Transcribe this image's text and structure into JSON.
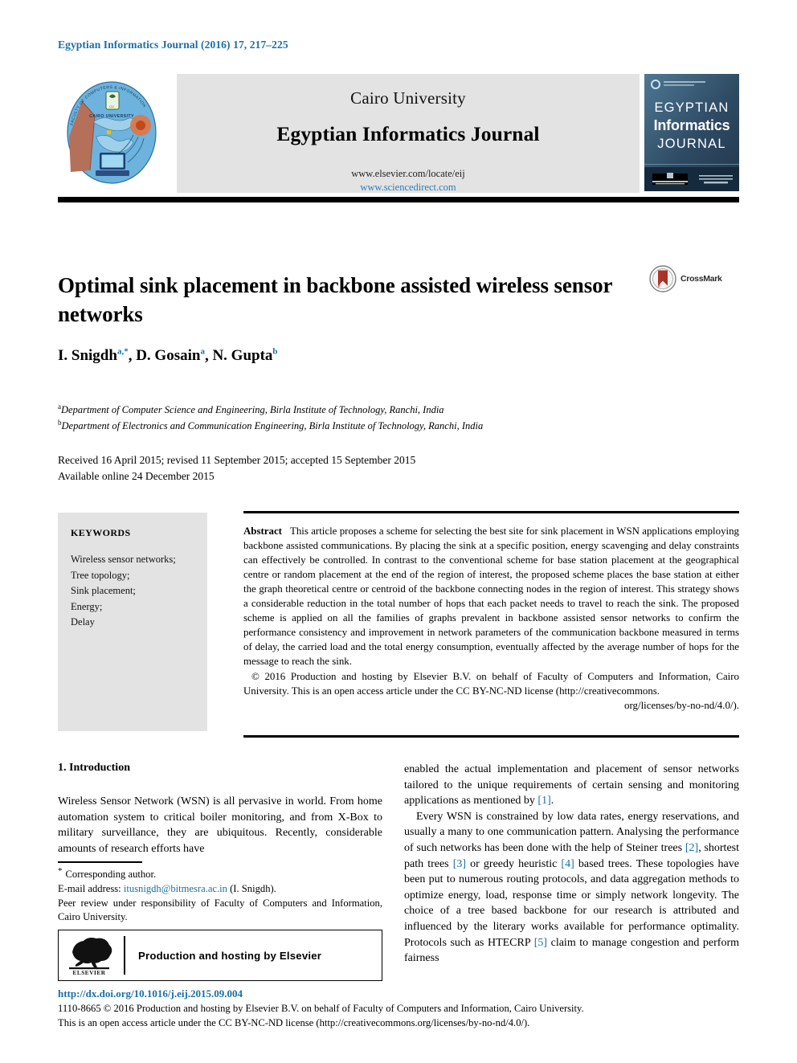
{
  "running_head": "Egyptian Informatics Journal (2016) 17, 217–225",
  "header": {
    "seal_alt": "cairo-university-faculty-of-computers-and-information-seal",
    "university": "Cairo University",
    "journal_name": "Egyptian Informatics Journal",
    "url_elsevier": "www.elsevier.com/locate/eij",
    "url_sciencedirect": "www.sciencedirect.com",
    "cover": {
      "line1": "EGYPTIAN",
      "line2": "Informatics",
      "line3": "JOURNAL"
    }
  },
  "article": {
    "title": "Optimal sink placement in backbone assisted wireless sensor networks",
    "crossmark_label": "CrossMark",
    "authors": [
      {
        "name": "I. Snigdh",
        "sup": "a,*"
      },
      {
        "name": "D. Gosain",
        "sup": "a"
      },
      {
        "name": "N. Gupta",
        "sup": "b"
      }
    ],
    "affiliations": [
      {
        "sup": "a",
        "text": "Department of Computer Science and Engineering, Birla Institute of Technology, Ranchi, India"
      },
      {
        "sup": "b",
        "text": "Department of Electronics and Communication Engineering, Birla Institute of Technology, Ranchi, India"
      }
    ],
    "dates_line1": "Received 16 April 2015; revised 11 September 2015; accepted 15 September 2015",
    "dates_line2": "Available online 24 December 2015"
  },
  "keywords": {
    "heading": "KEYWORDS",
    "items": [
      "Wireless sensor networks;",
      "Tree topology;",
      "Sink placement;",
      "Energy;",
      "Delay"
    ]
  },
  "abstract": {
    "label": "Abstract",
    "text": "This article proposes a scheme for selecting the best site for sink placement in WSN applications employing backbone assisted communications. By placing the sink at a specific position, energy scavenging and delay constraints can effectively be controlled. In contrast to the conventional scheme for base station placement at the geographical centre or random placement at the end of the region of interest, the proposed scheme places the base station at either the graph theoretical centre or centroid of the backbone connecting nodes in the region of interest. This strategy shows a considerable reduction in the total number of hops that each packet needs to travel to reach the sink. The proposed scheme is applied on all the families of graphs prevalent in backbone assisted sensor networks to confirm the performance consistency and improvement in network parameters of the communication backbone measured in terms of delay, the carried load and the total energy consumption, eventually affected by the average number of hops for the message to reach the sink.",
    "copyright": "© 2016 Production and hosting by Elsevier B.V. on behalf of Faculty of Computers and Information, Cairo University. This is an open access article under the CC BY-NC-ND license (http://creativecommons.",
    "copyright_lastline": "org/licenses/by-no-nd/4.0/)."
  },
  "introduction": {
    "heading": "1. Introduction",
    "para1": "Wireless Sensor Network (WSN) is all pervasive in world. From home automation system to critical boiler monitoring, and from X-Box to military surveillance, they are ubiquitous. Recently, considerable amounts of research efforts have",
    "right_para1_a": "enabled the actual implementation and placement of sensor networks tailored to the unique requirements of certain sensing and monitoring applications as mentioned by ",
    "right_para1_ref": "[1]",
    "right_para1_b": ".",
    "right_para2_a": "Every WSN is constrained by low data rates, energy reservations, and usually a many to one communication pattern. Analysing the performance of such networks has been done with the help of Steiner trees ",
    "right_para2_ref2": "[2]",
    "right_para2_b": ", shortest path trees ",
    "right_para2_ref3": "[3]",
    "right_para2_c": " or greedy heuristic ",
    "right_para2_ref4": "[4]",
    "right_para2_d": " based trees. These topologies have been put to numerous routing protocols, and data aggregation methods to optimize energy, load, response time or simply network longevity. The choice of a tree based backbone for our research is attributed and influenced by the literary works available for performance optimality. Protocols such as HTECRP ",
    "right_para2_ref5": "[5]",
    "right_para2_e": " claim to manage congestion and perform fairness"
  },
  "footnotes": {
    "corresponding": "Corresponding author.",
    "email_label": "E-mail address: ",
    "email": "itusnigdh@bitmesra.ac.in",
    "email_suffix": " (I. Snigdh).",
    "peer_review": "Peer review under responsibility of Faculty of Computers and Information, Cairo University."
  },
  "elsevier_box": {
    "logo_alt": "elsevier-tree-logo",
    "text": "Production and hosting by Elsevier"
  },
  "footer": {
    "doi": "http://dx.doi.org/10.1016/j.eij.2015.09.004",
    "legal_line1": "1110-8665 © 2016 Production and hosting by Elsevier B.V. on behalf of Faculty of Computers and Information, Cairo University.",
    "legal_line2": "This is an open access article under the CC BY-NC-ND license (http://creativecommons.org/licenses/by-no-nd/4.0/)."
  },
  "colors": {
    "link_blue": "#1a6fa8",
    "band_gray": "#e3e3e3",
    "rule_black": "#000000",
    "crossmark_red": "#a93226"
  }
}
